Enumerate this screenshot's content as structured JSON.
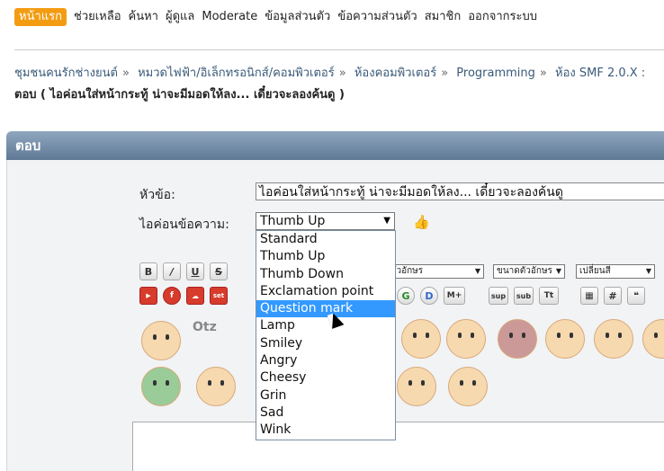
{
  "menu": {
    "items": [
      {
        "label": "หน้าแรก",
        "active": true
      },
      {
        "label": "ช่วยเหลือ"
      },
      {
        "label": "ค้นหา"
      },
      {
        "label": "ผู้ดูแล"
      },
      {
        "label": "Moderate"
      },
      {
        "label": "ข้อมูลส่วนตัว"
      },
      {
        "label": "ข้อความส่วนตัว"
      },
      {
        "label": "สมาชิก"
      },
      {
        "label": "ออกจากระบบ"
      }
    ]
  },
  "breadcrumb": {
    "items": [
      "ชุมชนคนรักช่างยนต์",
      "หมวดไฟฟ้า/อิเล็กทรอนิกส์/คอมพิวเตอร์",
      "ห้องคอมพิวเตอร์",
      "Programming",
      "ห้อง SMF 2.0.X :"
    ],
    "current": "ตอบ ( ไอค่อนใส่หน้ากระทู้ น่าจะมีมอดให้ลง... เดี๋ยวจะลองค้นดู )"
  },
  "panel": {
    "title": "ตอบ"
  },
  "form": {
    "subject_label": "หัวข้อ:",
    "subject_value": "ไอค่อนใส่หน้ากระทู้ น่าจะมีมอดให้ลง... เดี๋ยวจะลองค้นดู",
    "icon_label": "ไอค่อนข้อความ:",
    "icon_selected": "Thumb Up",
    "icon_options": [
      "Standard",
      "Thumb Up",
      "Thumb Down",
      "Exclamation point",
      "Question mark",
      "Lamp",
      "Smiley",
      "Angry",
      "Cheesy",
      "Grin",
      "Sad",
      "Wink"
    ],
    "highlighted_option": "Question mark"
  },
  "toolbar": {
    "bold": "B",
    "italic": "/",
    "underline": "U",
    "strike": "S",
    "font_select": "ตัวอักษร",
    "size_select": "ขนาดตัวอักษร",
    "color_select": "เปลี่ยนสี",
    "sup": "sup",
    "sub": "sub",
    "tt": "Tt",
    "g": "G",
    "d": "D",
    "mplus": "M+",
    "hash": "#",
    "set": "set",
    "smiley_label": "Otz"
  },
  "colors": {
    "accent": "#f39c12",
    "highlight": "#3399ff",
    "panel_head": "#6d86a1"
  }
}
